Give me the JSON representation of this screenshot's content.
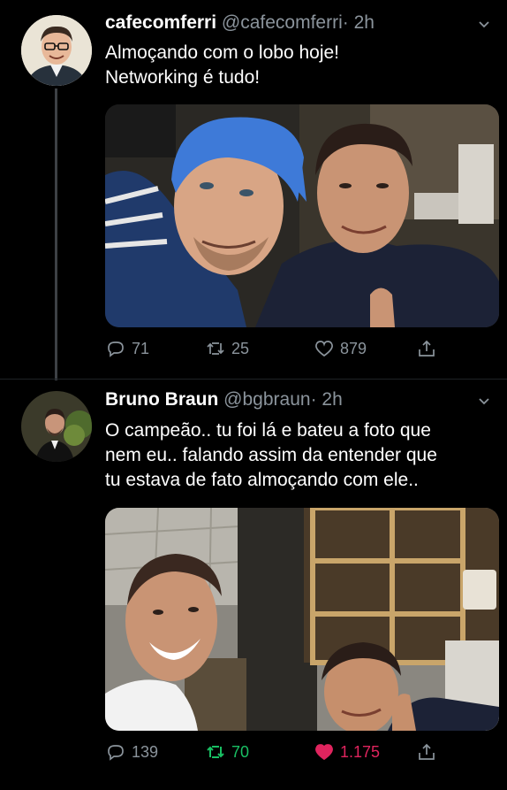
{
  "colors": {
    "background": "#000000",
    "secondary_text": "#8b949c",
    "retweet_active": "#19bf63",
    "like_active": "#e0245e"
  },
  "tweets": [
    {
      "name": "cafecomferri",
      "handle": "@cafecomferri",
      "time": "· 2h",
      "text_lines": [
        "Almoçando com o lobo hoje!",
        "Networking é tudo!"
      ],
      "replies": "71",
      "retweets": "25",
      "likes": "879",
      "retweeted": false,
      "liked": false
    },
    {
      "name": "Bruno Braun",
      "handle": "@bgbraun",
      "time": "· 2h",
      "text_lines": [
        "O campeão.. tu foi lá e bateu a foto que",
        "nem eu.. falando assim da entender que",
        "tu estava de fato almoçando com ele.."
      ],
      "replies": "139",
      "retweets": "70",
      "likes": "1.175",
      "retweeted": true,
      "liked": true
    }
  ]
}
